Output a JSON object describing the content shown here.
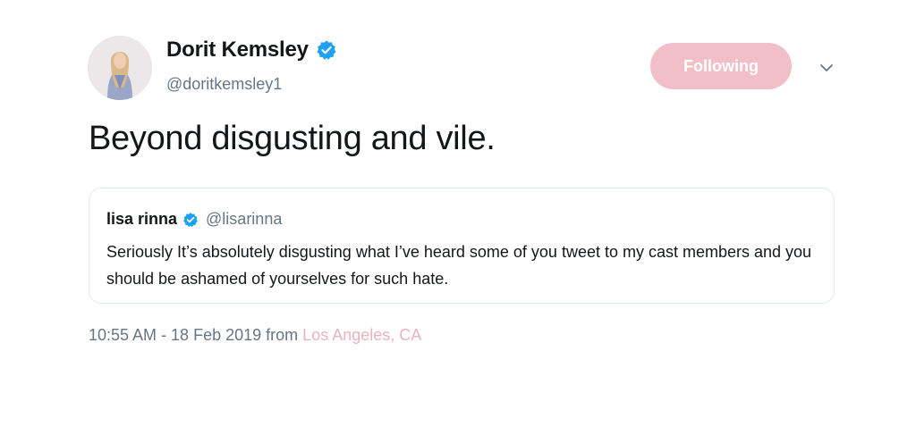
{
  "author": {
    "name": "Dorit Kemsley",
    "handle": "@doritkemsley1",
    "verified": true,
    "avatar_icon": "profile-photo"
  },
  "actions": {
    "follow_label": "Following",
    "menu_icon": "chevron-down-icon"
  },
  "tweet": {
    "text": "Beyond disgusting and vile."
  },
  "quoted_tweet": {
    "name": "lisa rinna",
    "handle": "@lisarinna",
    "verified": true,
    "text": "Seriously It’s absolutely disgusting what I’ve heard some of you tweet to my cast members and you should be ashamed of yourselves for such hate."
  },
  "meta": {
    "timestamp": "10:55 AM - 18 Feb 2019",
    "from_label": "from",
    "location": "Los Angeles, CA"
  },
  "colors": {
    "verified_blue": "#1da1f2",
    "follow_button_bg": "#f2bfc8",
    "location_link": "#eab3bd",
    "secondary_text": "#657786"
  }
}
